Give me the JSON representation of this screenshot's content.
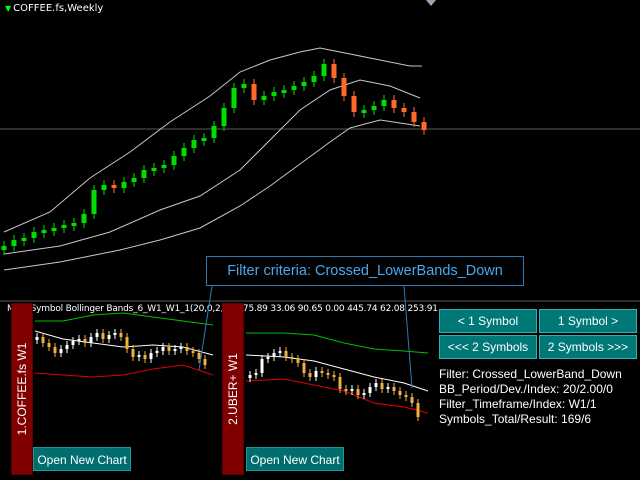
{
  "main_chart": {
    "title": "COFFEE.fs,Weekly",
    "colors": {
      "bull": "#00dd00",
      "bear": "#ff6a2a",
      "band": "#c8c8c8",
      "hline": "#5a5a5a"
    }
  },
  "callout": {
    "text": "Filter criteria: Crossed_LowerBands_Down"
  },
  "panel": {
    "indicator_label": "Multi Symbol Bollinger Bands_6_W1_W1_1(20,0,2,1,2) 75.89 33.06 90.65 0.00 445.74 62.08 253.91",
    "slots": [
      {
        "label": "1.COFFEE.fs  W1",
        "button": "Open New Chart"
      },
      {
        "label": "2.UBER+  W1",
        "button": "Open New Chart"
      }
    ],
    "nav_buttons": {
      "prev1": "< 1 Symbol",
      "next1": "1 Symbol >",
      "prev2": "<<< 2 Symbols",
      "next2": "2 Symbols >>>"
    },
    "info": [
      "Filter: Crossed_LowerBand_Down",
      "BB_Period/Dev./Index: 20/2.00/0",
      "Filter_Timeframe/Index: W1/1",
      "Symbols_Total/Result: 169/6"
    ],
    "colors": {
      "tab": "#800000",
      "button": "#007878",
      "upper_band": "#00c000",
      "mid_band": "#ffffff",
      "lower_band": "#e00000",
      "mini_bull": "#ffffff",
      "mini_bear": "#f0b040"
    }
  }
}
